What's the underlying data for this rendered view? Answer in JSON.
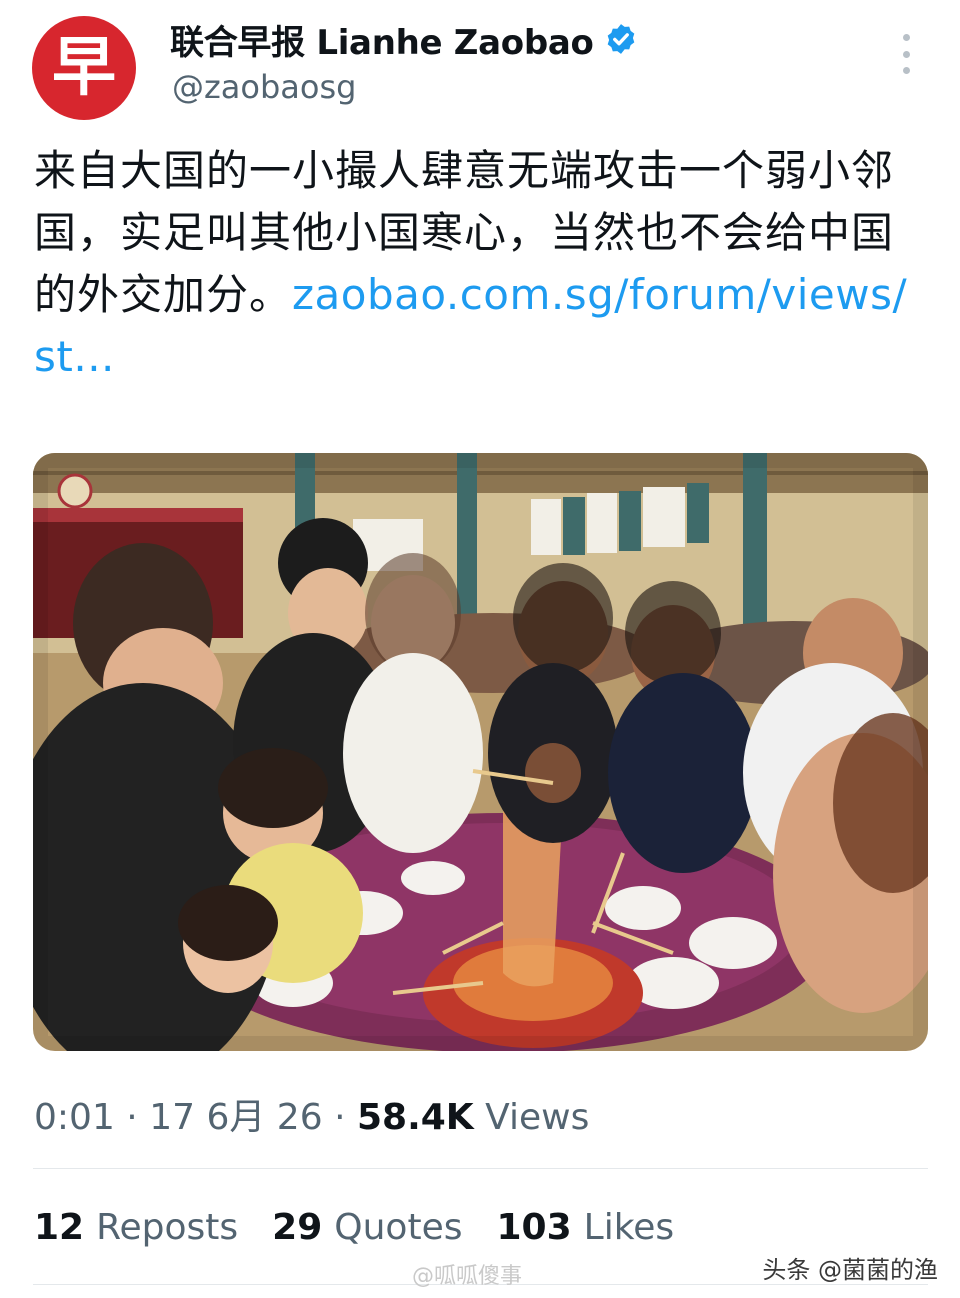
{
  "account": {
    "avatar_char": "早",
    "display_name": "联合早报 Lianhe Zaobao",
    "handle": "@zaobaosg"
  },
  "tweet": {
    "text": "来自大国的一小撮人肆意无端攻击一个弱小邻国，实足叫其他小国寒心，当然也不会给中国的外交加分。",
    "link": "zaobao.com.sg/forum/views/st..."
  },
  "meta": {
    "time": "0:01",
    "separator": "·",
    "date": "17 6月 26",
    "views_count": "58.4K",
    "views_label": "Views"
  },
  "stats": {
    "reposts_count": "12",
    "reposts_label": "Reposts",
    "quotes_count": "29",
    "quotes_label": "Quotes",
    "likes_count": "103",
    "likes_label": "Likes"
  },
  "watermarks": {
    "weibo": "@呱呱傻事",
    "toutiao": "头条 @菌菌的渔"
  },
  "colors": {
    "link": "#1d9bf0",
    "verified": "#1d9bf0",
    "secondary_text": "#536471",
    "avatar_bg": "#d7262e"
  },
  "icons": {
    "verified": "verified-badge-icon",
    "more": "more-options-icon"
  }
}
